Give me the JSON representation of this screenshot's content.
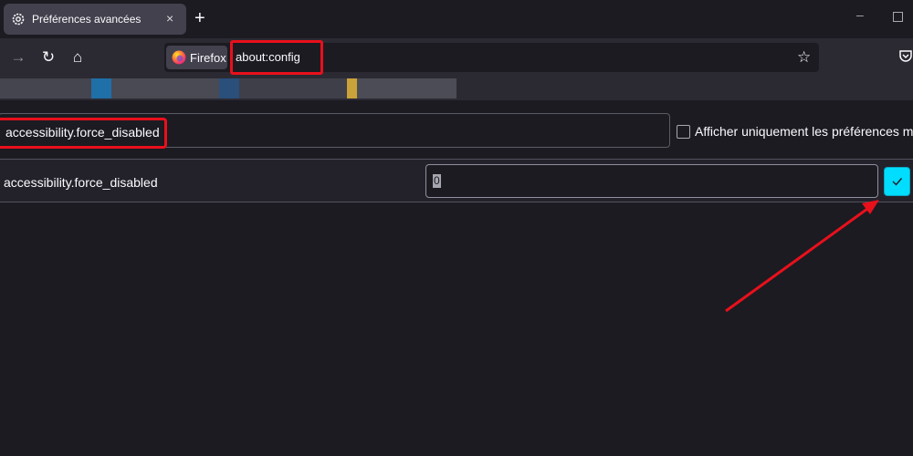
{
  "tab": {
    "title": "Préférences avancées",
    "close": "×",
    "new_tab": "+"
  },
  "window": {
    "minimize": "–"
  },
  "navbar": {
    "forward": "→",
    "reload": "↻",
    "home": "⌂",
    "identity_label": "Firefox",
    "url": "about:config",
    "bookmark_star": "☆"
  },
  "search": {
    "value": "accessibility.force_disabled",
    "checkbox_label": "Afficher uniquement les préférences mod"
  },
  "preference": {
    "name": "accessibility.force_disabled",
    "value": "0"
  },
  "colors": {
    "highlight": "#e8101b",
    "accent": "#00ddff",
    "background": "#1c1b22"
  },
  "icons": [
    "gear-icon",
    "close-icon",
    "plus-icon",
    "forward-arrow-icon",
    "reload-icon",
    "home-icon",
    "firefox-logo-icon",
    "star-icon",
    "pocket-icon",
    "checkmark-icon"
  ]
}
